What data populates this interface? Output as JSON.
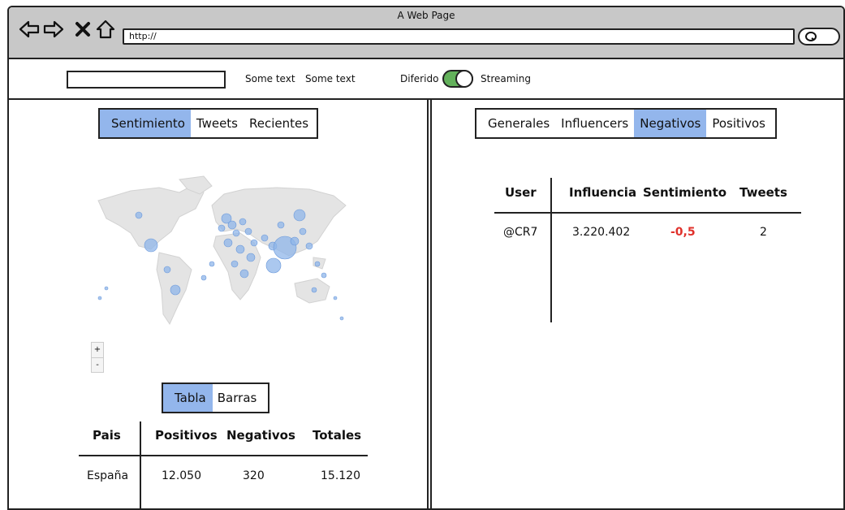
{
  "browser": {
    "title": "A Web Page",
    "url": "http://"
  },
  "toolbar": {
    "text1": "Some text",
    "text2": "Some text",
    "toggle_left": "Diferido",
    "toggle_right": "Streaming",
    "toggle_on": true
  },
  "left_tabs": [
    {
      "label": "Sentimiento",
      "active": true
    },
    {
      "label": "Tweets",
      "active": false
    },
    {
      "label": "Recientes",
      "active": false
    }
  ],
  "map": {
    "zoom_in": "+",
    "zoom_out": "-"
  },
  "view_tabs": [
    {
      "label": "Tabla",
      "active": true
    },
    {
      "label": "Barras",
      "active": false
    }
  ],
  "country_table": {
    "headers": [
      "Pais",
      "Positivos",
      "Negativos",
      "Totales"
    ],
    "rows": [
      [
        "España",
        "12.050",
        "320",
        "15.120"
      ]
    ]
  },
  "right_tabs": [
    {
      "label": "Generales",
      "active": false
    },
    {
      "label": "Influencers",
      "active": false
    },
    {
      "label": "Negativos",
      "active": true
    },
    {
      "label": "Positivos",
      "active": false
    }
  ],
  "user_table": {
    "headers": [
      "User",
      "Influencia",
      "Sentimiento",
      "Tweets"
    ],
    "rows": [
      [
        "@CR7",
        "3.220.402",
        "-0,5",
        "2"
      ]
    ]
  },
  "colors": {
    "active_tab": "#93b6ec",
    "negative": "#e0312b",
    "toggle": "#63b15b",
    "chrome": "#c8c8c8"
  }
}
